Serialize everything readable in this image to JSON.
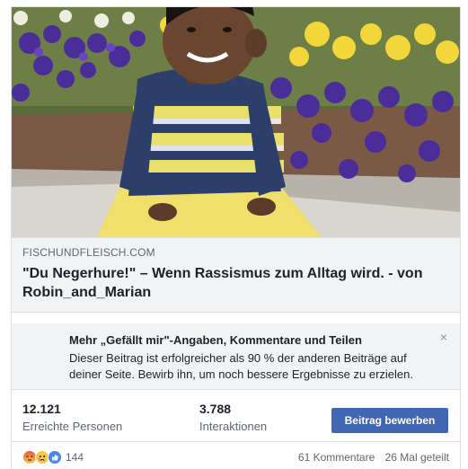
{
  "link_preview": {
    "image_description_icon": "photo",
    "domain": "FISCHUNDFLEISCH.COM",
    "headline": "\"Du Negerhure!\" – Wenn Rassismus zum Alltag wird. - von Robin_and_Marian"
  },
  "boost_notice": {
    "title": "Mehr „Gefällt mir\"-Angaben, Kommentare und Teilen",
    "text": "Dieser Beitrag ist erfolgreicher als 90 % der anderen Beiträge auf deiner Seite. Bewirb ihn, um noch bessere Ergebnisse zu erzielen.",
    "close_glyph": "×"
  },
  "stats": {
    "reach_value": "12.121",
    "reach_label": "Erreichte Personen",
    "interactions_value": "3.788",
    "interactions_label": "Interaktionen",
    "boost_button": "Beitrag bewerben"
  },
  "footer": {
    "reaction_icons": [
      "angry-icon",
      "sad-icon",
      "like-icon"
    ],
    "reaction_count": "144",
    "comments": "61 Kommentare",
    "shares": "26 Mal geteilt"
  },
  "colors": {
    "accent": "#4267b2",
    "meta_bg": "#f2f3f5",
    "muted_text": "#606770"
  }
}
